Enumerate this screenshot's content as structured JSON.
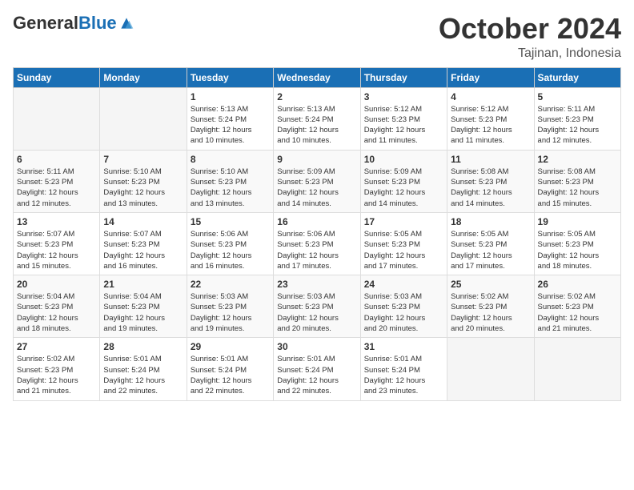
{
  "header": {
    "logo_general": "General",
    "logo_blue": "Blue",
    "month_title": "October 2024",
    "location": "Tajinan, Indonesia"
  },
  "weekdays": [
    "Sunday",
    "Monday",
    "Tuesday",
    "Wednesday",
    "Thursday",
    "Friday",
    "Saturday"
  ],
  "weeks": [
    [
      {
        "day": "",
        "info": ""
      },
      {
        "day": "",
        "info": ""
      },
      {
        "day": "1",
        "info": "Sunrise: 5:13 AM\nSunset: 5:24 PM\nDaylight: 12 hours\nand 10 minutes."
      },
      {
        "day": "2",
        "info": "Sunrise: 5:13 AM\nSunset: 5:24 PM\nDaylight: 12 hours\nand 10 minutes."
      },
      {
        "day": "3",
        "info": "Sunrise: 5:12 AM\nSunset: 5:23 PM\nDaylight: 12 hours\nand 11 minutes."
      },
      {
        "day": "4",
        "info": "Sunrise: 5:12 AM\nSunset: 5:23 PM\nDaylight: 12 hours\nand 11 minutes."
      },
      {
        "day": "5",
        "info": "Sunrise: 5:11 AM\nSunset: 5:23 PM\nDaylight: 12 hours\nand 12 minutes."
      }
    ],
    [
      {
        "day": "6",
        "info": "Sunrise: 5:11 AM\nSunset: 5:23 PM\nDaylight: 12 hours\nand 12 minutes."
      },
      {
        "day": "7",
        "info": "Sunrise: 5:10 AM\nSunset: 5:23 PM\nDaylight: 12 hours\nand 13 minutes."
      },
      {
        "day": "8",
        "info": "Sunrise: 5:10 AM\nSunset: 5:23 PM\nDaylight: 12 hours\nand 13 minutes."
      },
      {
        "day": "9",
        "info": "Sunrise: 5:09 AM\nSunset: 5:23 PM\nDaylight: 12 hours\nand 14 minutes."
      },
      {
        "day": "10",
        "info": "Sunrise: 5:09 AM\nSunset: 5:23 PM\nDaylight: 12 hours\nand 14 minutes."
      },
      {
        "day": "11",
        "info": "Sunrise: 5:08 AM\nSunset: 5:23 PM\nDaylight: 12 hours\nand 14 minutes."
      },
      {
        "day": "12",
        "info": "Sunrise: 5:08 AM\nSunset: 5:23 PM\nDaylight: 12 hours\nand 15 minutes."
      }
    ],
    [
      {
        "day": "13",
        "info": "Sunrise: 5:07 AM\nSunset: 5:23 PM\nDaylight: 12 hours\nand 15 minutes."
      },
      {
        "day": "14",
        "info": "Sunrise: 5:07 AM\nSunset: 5:23 PM\nDaylight: 12 hours\nand 16 minutes."
      },
      {
        "day": "15",
        "info": "Sunrise: 5:06 AM\nSunset: 5:23 PM\nDaylight: 12 hours\nand 16 minutes."
      },
      {
        "day": "16",
        "info": "Sunrise: 5:06 AM\nSunset: 5:23 PM\nDaylight: 12 hours\nand 17 minutes."
      },
      {
        "day": "17",
        "info": "Sunrise: 5:05 AM\nSunset: 5:23 PM\nDaylight: 12 hours\nand 17 minutes."
      },
      {
        "day": "18",
        "info": "Sunrise: 5:05 AM\nSunset: 5:23 PM\nDaylight: 12 hours\nand 17 minutes."
      },
      {
        "day": "19",
        "info": "Sunrise: 5:05 AM\nSunset: 5:23 PM\nDaylight: 12 hours\nand 18 minutes."
      }
    ],
    [
      {
        "day": "20",
        "info": "Sunrise: 5:04 AM\nSunset: 5:23 PM\nDaylight: 12 hours\nand 18 minutes."
      },
      {
        "day": "21",
        "info": "Sunrise: 5:04 AM\nSunset: 5:23 PM\nDaylight: 12 hours\nand 19 minutes."
      },
      {
        "day": "22",
        "info": "Sunrise: 5:03 AM\nSunset: 5:23 PM\nDaylight: 12 hours\nand 19 minutes."
      },
      {
        "day": "23",
        "info": "Sunrise: 5:03 AM\nSunset: 5:23 PM\nDaylight: 12 hours\nand 20 minutes."
      },
      {
        "day": "24",
        "info": "Sunrise: 5:03 AM\nSunset: 5:23 PM\nDaylight: 12 hours\nand 20 minutes."
      },
      {
        "day": "25",
        "info": "Sunrise: 5:02 AM\nSunset: 5:23 PM\nDaylight: 12 hours\nand 20 minutes."
      },
      {
        "day": "26",
        "info": "Sunrise: 5:02 AM\nSunset: 5:23 PM\nDaylight: 12 hours\nand 21 minutes."
      }
    ],
    [
      {
        "day": "27",
        "info": "Sunrise: 5:02 AM\nSunset: 5:23 PM\nDaylight: 12 hours\nand 21 minutes."
      },
      {
        "day": "28",
        "info": "Sunrise: 5:01 AM\nSunset: 5:24 PM\nDaylight: 12 hours\nand 22 minutes."
      },
      {
        "day": "29",
        "info": "Sunrise: 5:01 AM\nSunset: 5:24 PM\nDaylight: 12 hours\nand 22 minutes."
      },
      {
        "day": "30",
        "info": "Sunrise: 5:01 AM\nSunset: 5:24 PM\nDaylight: 12 hours\nand 22 minutes."
      },
      {
        "day": "31",
        "info": "Sunrise: 5:01 AM\nSunset: 5:24 PM\nDaylight: 12 hours\nand 23 minutes."
      },
      {
        "day": "",
        "info": ""
      },
      {
        "day": "",
        "info": ""
      }
    ]
  ]
}
